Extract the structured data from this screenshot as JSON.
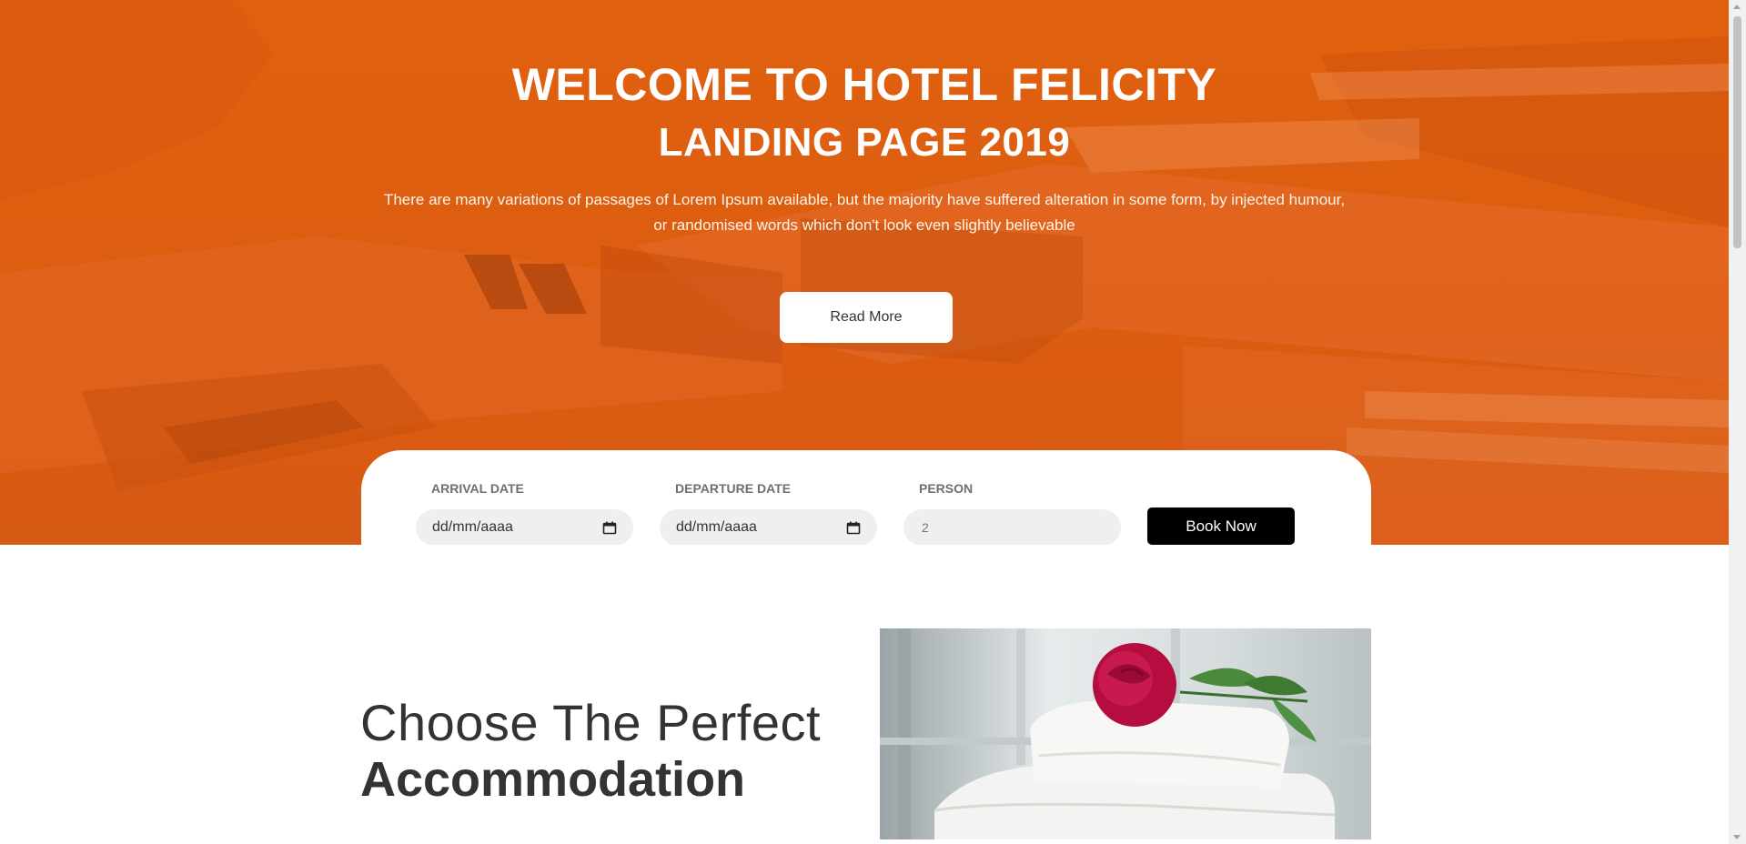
{
  "hero": {
    "title": "WELCOME TO HOTEL FELICITY",
    "subtitle": "LANDING PAGE 2019",
    "text_line1": "There are many variations of passages of Lorem Ipsum available, but the majority have suffered alteration in some form, by injected humour,",
    "text_line2": "or randomised words which don't look even slightly believable",
    "read_more_label": "Read More",
    "overlay_color": "#e0600f"
  },
  "booking": {
    "arrival_label": "ARRIVAL DATE",
    "arrival_value": "dd/mm/aaaa",
    "departure_label": "DEPARTURE DATE",
    "departure_value": "dd/mm/aaaa",
    "person_label": "PERSON",
    "person_placeholder": "2",
    "book_label": "Book Now",
    "calendar_icon": "calendar-icon"
  },
  "accommodation": {
    "title_light": "Choose The Perfect",
    "title_bold": "Accommodation",
    "image_icon": "rose-on-towels-image"
  }
}
